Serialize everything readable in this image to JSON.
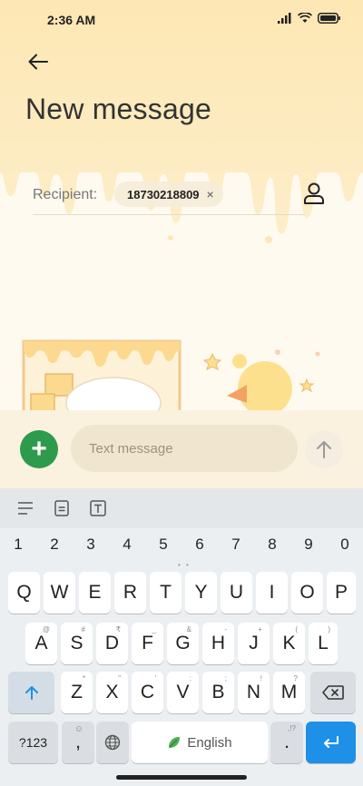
{
  "status_bar": {
    "time": "2:36 AM"
  },
  "header": {
    "title": "New message"
  },
  "recipient": {
    "label": "Recipient:",
    "chip_number": "18730218809",
    "chip_close": "×"
  },
  "compose": {
    "placeholder": "Text message",
    "add_symbol": "+"
  },
  "keyboard": {
    "numbers": [
      "1",
      "2",
      "3",
      "4",
      "5",
      "6",
      "7",
      "8",
      "9",
      "0"
    ],
    "row1": [
      "Q",
      "W",
      "E",
      "R",
      "T",
      "Y",
      "U",
      "I",
      "O",
      "P"
    ],
    "row2": [
      "A",
      "S",
      "D",
      "F",
      "G",
      "H",
      "J",
      "K",
      "L"
    ],
    "row2_hints": [
      "@",
      "#",
      "₹",
      "_",
      "&",
      "-",
      "+",
      "(",
      ")"
    ],
    "row3": [
      "Z",
      "X",
      "C",
      "V",
      "B",
      "N",
      "M"
    ],
    "row3_hints": [
      "*",
      "\"",
      "'",
      ":",
      ";",
      "!",
      "?"
    ],
    "symbols_key": "?123",
    "comma_key": ",",
    "space_label": "English",
    "period_key": ".",
    "period_hint": ",!?"
  },
  "colors": {
    "accent_green": "#2e9a4b",
    "enter_blue": "#1e90e8",
    "header_yellow": "#fde9b8"
  }
}
